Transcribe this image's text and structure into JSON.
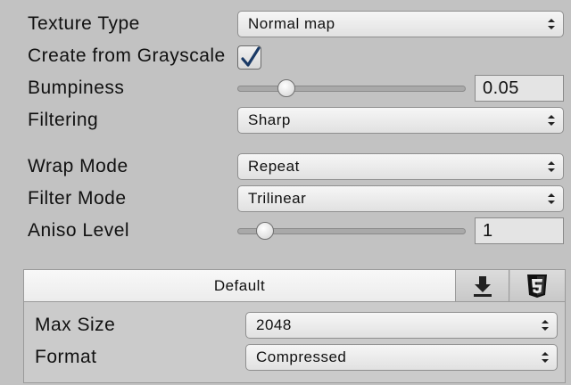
{
  "fields": {
    "texture_type": {
      "label": "Texture Type",
      "value": "Normal map"
    },
    "create_from_grayscale": {
      "label": "Create from Grayscale",
      "checked": true
    },
    "bumpiness": {
      "label": "Bumpiness",
      "value": "0.05",
      "level": 0.19
    },
    "filtering": {
      "label": "Filtering",
      "value": "Sharp"
    },
    "wrap_mode": {
      "label": "Wrap Mode",
      "value": "Repeat"
    },
    "filter_mode": {
      "label": "Filter Mode",
      "value": "Trilinear"
    },
    "aniso_level": {
      "label": "Aniso Level",
      "value": "1",
      "level": 0.09
    }
  },
  "platform_panel": {
    "tabs": [
      {
        "label": "Default",
        "selected": true
      },
      {
        "icon": "download-icon"
      },
      {
        "icon": "html5-icon"
      }
    ],
    "max_size": {
      "label": "Max Size",
      "value": "2048"
    },
    "format": {
      "label": "Format",
      "value": "Compressed"
    }
  },
  "colors": {
    "background": "#c2c2c2",
    "checkmark": "#1a3a66"
  }
}
